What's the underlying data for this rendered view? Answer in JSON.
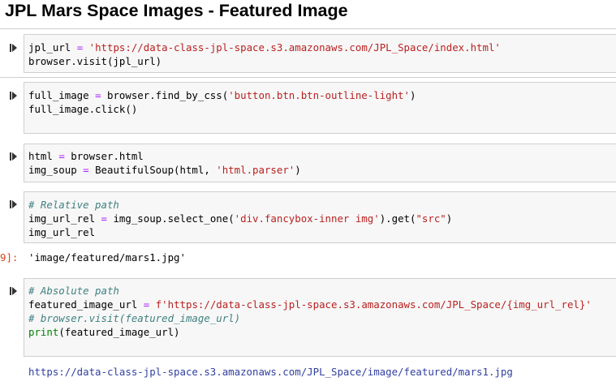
{
  "heading": "JPL Mars Space Images - Featured Image",
  "run_icon": "run-cell-icon",
  "cells": [
    {
      "line1": {
        "a": "jpl_url ",
        "op": "=",
        "sp": " ",
        "str": "'https://data-class-jpl-space.s3.amazonaws.com/JPL_Space/index.html'"
      },
      "line2": "browser.visit(jpl_url)"
    },
    {
      "line1": {
        "a": "full_image ",
        "op": "=",
        "b": " browser.find_by_css(",
        "str": "'button.btn.btn-outline-light'",
        "c": ")"
      },
      "line2": "full_image.click()"
    },
    {
      "line1": {
        "a": "html ",
        "op": "=",
        "b": " browser.html"
      },
      "line2": {
        "a": "img_soup ",
        "op": "=",
        "b": " BeautifulSoup(html, ",
        "str": "'html.parser'",
        "c": ")"
      }
    },
    {
      "comment": "# Relative path",
      "line2": {
        "a": "img_url_rel ",
        "op": "=",
        "b": " img_soup.select_one(",
        "str": "'div.fancybox-inner img'",
        "c": ").get(",
        "str2": "\"src\"",
        "d": ")"
      },
      "line3": "img_url_rel"
    },
    {
      "comment": "# Absolute path",
      "line2": {
        "a": "featured_image_url ",
        "op": "=",
        "sp": " ",
        "str": "f'https://data-class-jpl-space.s3.amazonaws.com/JPL_Space/{img_url_rel}'"
      },
      "comment2": "# browser.visit(featured_image_url)",
      "line4": {
        "fn": "print",
        "b": "(featured_image_url)"
      }
    }
  ],
  "output1": {
    "prompt": "9]:",
    "text": "'image/featured/mars1.jpg'"
  },
  "output2": {
    "text": "https://data-class-jpl-space.s3.amazonaws.com/JPL_Space/image/featured/mars1.jpg"
  },
  "colors": {
    "string": "#ba2121",
    "operator": "#aa22ff",
    "comment": "#408080",
    "builtin": "#008000",
    "out_prompt": "#d84315",
    "link": "#303f9f",
    "cell_bg": "#f7f7f7",
    "cell_border": "#cfcfcf"
  }
}
